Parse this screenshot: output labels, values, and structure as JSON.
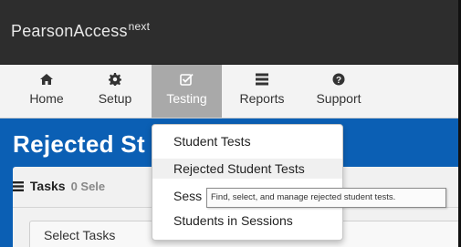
{
  "app": {
    "brand": "PearsonAccess",
    "brand_suffix": "next"
  },
  "nav": {
    "items": [
      {
        "label": "Home",
        "icon": "home-icon"
      },
      {
        "label": "Setup",
        "icon": "gear-icon"
      },
      {
        "label": "Testing",
        "icon": "checkbox-icon",
        "active": true
      },
      {
        "label": "Reports",
        "icon": "reports-icon"
      },
      {
        "label": "Support",
        "icon": "help-icon"
      }
    ]
  },
  "page": {
    "title": "Rejected St"
  },
  "tasks": {
    "label": "Tasks",
    "count_text": "0 Sele",
    "select_label": "Select Tasks"
  },
  "menu": {
    "items": [
      {
        "label": "Student Tests"
      },
      {
        "label": "Rejected Student Tests",
        "hovered": true
      },
      {
        "label": "Sess"
      },
      {
        "label": "Students in Sessions"
      }
    ]
  },
  "tooltip": {
    "text": "Find, select, and manage rejected student tests."
  },
  "colors": {
    "brand_bar": "#2d2d2d",
    "banner": "#0b5fb4",
    "active_nav": "#a9a9a9"
  }
}
